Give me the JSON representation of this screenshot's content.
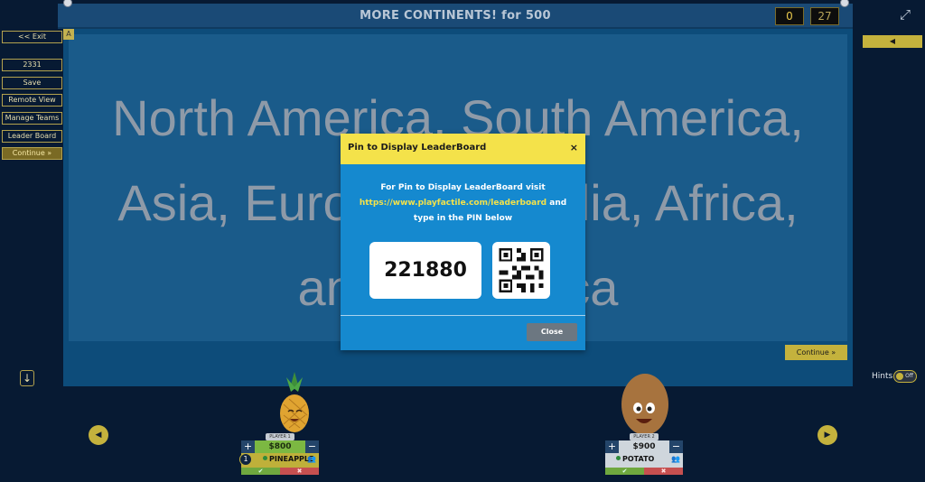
{
  "header": {
    "title": "MORE CONTINENTS! for 500",
    "score_left": "0",
    "score_right": "27"
  },
  "sidebar": {
    "exit": "<< Exit",
    "code": "2331",
    "save": "Save",
    "remote_view": "Remote View",
    "manage_teams": "Manage Teams",
    "leader_board": "Leader Board",
    "continue": "Continue »"
  },
  "category_letter": "A",
  "right_button": "◀",
  "board": {
    "answer": "North America, South America, Asia, Europe, Australia, Africa, and Antarctica",
    "continue": "Continue »"
  },
  "hints": {
    "label": "Hints",
    "state": "Off"
  },
  "modal": {
    "title": "Pin to Display LeaderBoard",
    "close_x": "×",
    "message_line1": "For Pin to Display LeaderBoard visit",
    "link": "https://www.playfactile.com/leaderboard",
    "message_and": " and",
    "message_line3": "type in the PIN below",
    "pin": "221880",
    "close_button": "Close"
  },
  "players": [
    {
      "label": "PLAYER 1",
      "score": "$800",
      "name": "PINEAPPLE",
      "rank": "1"
    },
    {
      "label": "PLAYER 2",
      "score": "$900",
      "name": "POTATO"
    }
  ],
  "colors": {
    "accent_yellow": "#c4b23d",
    "modal_blue": "#1589cf",
    "board_blue": "#0d4c7a"
  }
}
